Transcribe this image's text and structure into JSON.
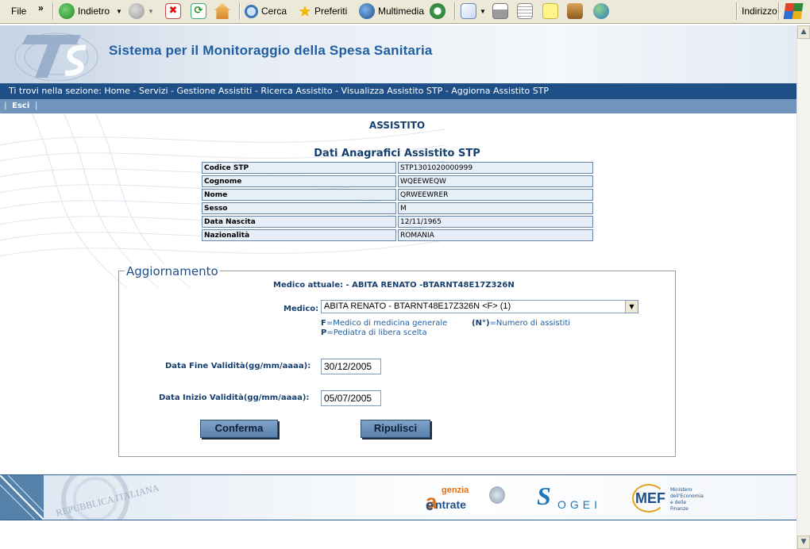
{
  "toolbar": {
    "file": "File",
    "more": "»",
    "back": "Indietro",
    "search": "Cerca",
    "favorites": "Preferiti",
    "media": "Multimedia",
    "address": "Indirizzo"
  },
  "header": {
    "title": "Sistema per il Monitoraggio della Spesa Sanitaria",
    "logo_text": "TS"
  },
  "breadcrumb": "Ti trovi nella sezione: Home - Servizi - Gestione Assistiti - Ricerca Assistito - Visualizza Assistito STP - Aggiorna Assistito STP",
  "menu": {
    "exit": "Esci"
  },
  "main": {
    "heading": "ASSISTITO",
    "subheading": "Dati Anagrafici Assistito STP",
    "rows": [
      {
        "label": "Codice STP",
        "value": "STP1301020000999"
      },
      {
        "label": "Cognome",
        "value": "WQEEWEQW"
      },
      {
        "label": "Nome",
        "value": "QRWEEWRER"
      },
      {
        "label": "Sesso",
        "value": "M"
      },
      {
        "label": "Data Nascita",
        "value": "12/11/1965"
      },
      {
        "label": "Nazionalità",
        "value": "ROMANIA"
      }
    ]
  },
  "form": {
    "legend": "Aggiornamento",
    "current_doctor": "Medico attuale: - ABITA  RENATO -BTARNT48E17Z326N",
    "doctor_label": "Medico:",
    "doctor_value": "ABITA RENATO - BTARNT48E17Z326N <F> (1)",
    "note_f_key": "F",
    "note_f_text": "=Medico di medicina generale",
    "note_n_key": "(N°)",
    "note_n_text": "=Numero di assistiti",
    "note_p_key": "P",
    "note_p_text": "=Pediatra di libera scelta",
    "end_label": "Data Fine Validità(gg/mm/aaaa):",
    "end_value": "30/12/2005",
    "start_label": "Data Inizio Validità(gg/mm/aaaa):",
    "start_value": "05/07/2005",
    "confirm": "Conferma",
    "reset": "Ripulisci"
  },
  "footer": {
    "agenzia_top": "genzia",
    "agenzia_bottom": "ntrate",
    "sogei": "OGEI",
    "mef": "MEF",
    "mef_small": "Ministero dell'Economia e delle Finanze",
    "seal_text": "REPUBBLICA ITALIANA"
  },
  "colors": {
    "brand_blue": "#1f4f87",
    "title_blue": "#1f5ea3",
    "menu_blue": "#6f95bd"
  }
}
